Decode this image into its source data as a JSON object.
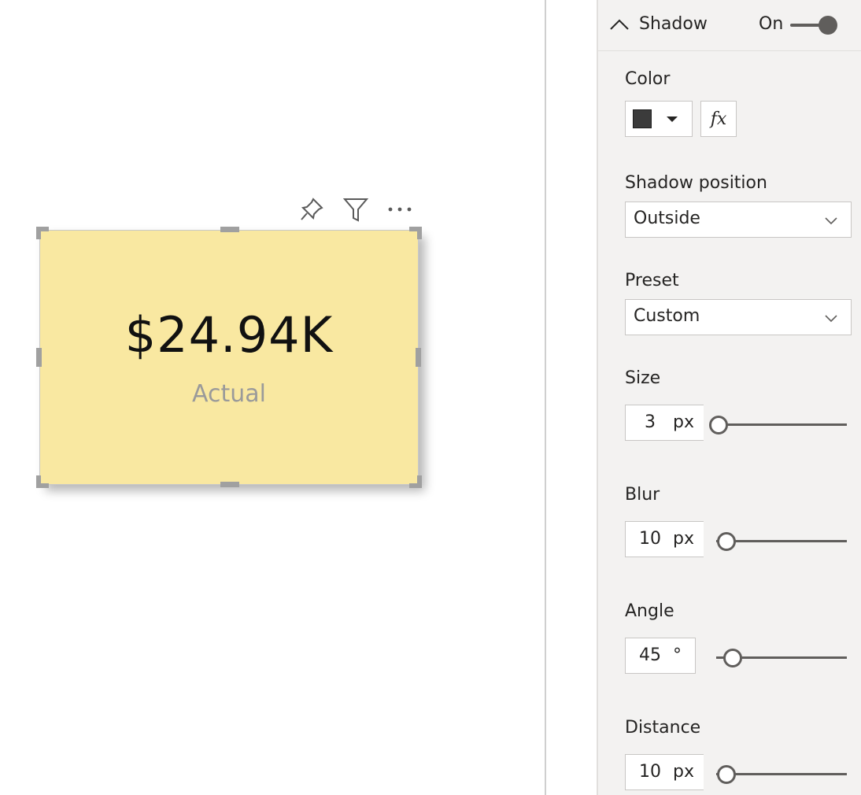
{
  "card": {
    "value": "$24.94K",
    "label": "Actual",
    "background": "#f9e8a1"
  },
  "visual_header": {
    "icons": [
      "pin-icon",
      "filter-icon",
      "more-options-icon"
    ]
  },
  "shadow": {
    "title": "Shadow",
    "state_label": "On",
    "toggle_on": true,
    "color": {
      "label": "Color",
      "value": "#3b3b3b",
      "fx_label": "fx"
    },
    "position": {
      "label": "Shadow position",
      "value": "Outside"
    },
    "preset": {
      "label": "Preset",
      "value": "Custom"
    },
    "size": {
      "label": "Size",
      "value": "3",
      "unit": "px",
      "fraction": 0.02
    },
    "blur": {
      "label": "Blur",
      "value": "10",
      "unit": "px",
      "fraction": 0.08
    },
    "angle": {
      "label": "Angle",
      "value": "45",
      "unit": "°",
      "fraction": 0.125
    },
    "distance": {
      "label": "Distance",
      "value": "10",
      "unit": "px",
      "fraction": 0.08
    }
  },
  "colors": {
    "pane": "#f3f2f1",
    "accent": "#605e5c"
  }
}
